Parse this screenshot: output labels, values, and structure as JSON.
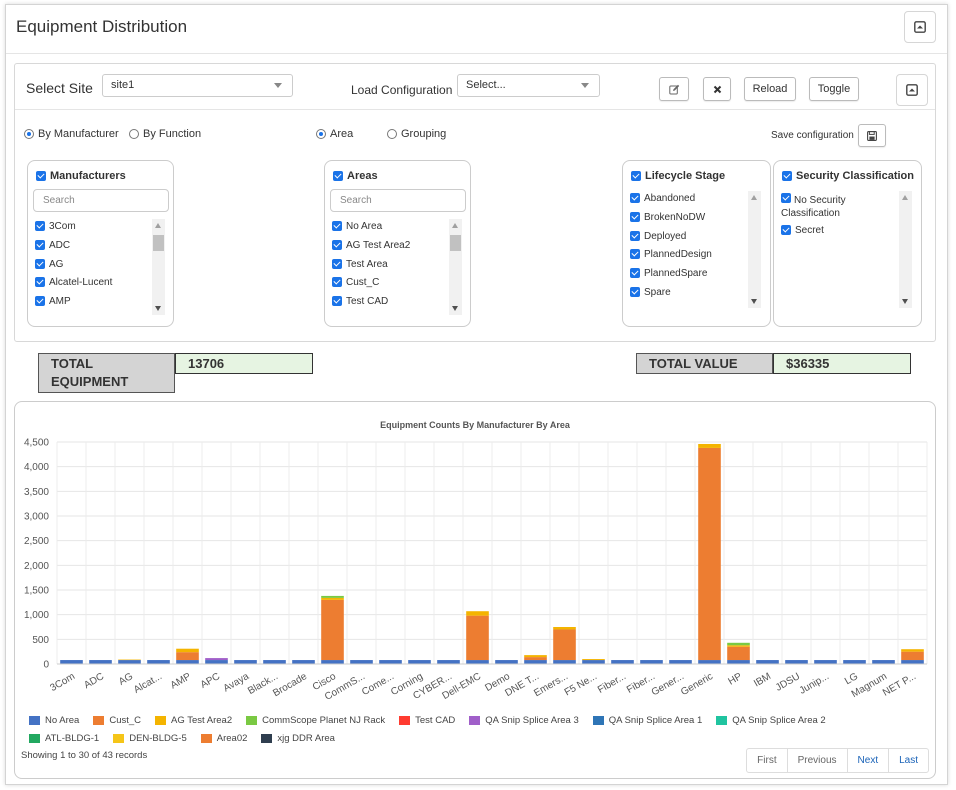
{
  "page": {
    "title": "Equipment Distribution"
  },
  "toolbar": {
    "select_site_label": "Select Site",
    "site_value": "site1",
    "load_config_label": "Load Configuration",
    "load_config_placeholder": "Select...",
    "reload_label": "Reload",
    "toggle_label": "Toggle",
    "save_config_label": "Save configuration"
  },
  "modes": {
    "by_manufacturer": "By Manufacturer",
    "by_function": "By Function",
    "area": "Area",
    "grouping": "Grouping"
  },
  "filters": {
    "manufacturers": {
      "title": "Manufacturers",
      "search_placeholder": "Search",
      "items": [
        "3Com",
        "ADC",
        "AG",
        "Alcatel-Lucent",
        "AMP"
      ]
    },
    "areas": {
      "title": "Areas",
      "search_placeholder": "Search",
      "items": [
        "No Area",
        "AG Test Area2",
        "Test Area",
        "Cust_C",
        "Test CAD"
      ]
    },
    "lifecycle": {
      "title": "Lifecycle Stage",
      "items": [
        "Abandoned",
        "BrokenNoDW",
        "Deployed",
        "PlannedDesign",
        "PlannedSpare",
        "Spare"
      ]
    },
    "security": {
      "title": "Security Classification",
      "items": [
        "No Security Classification",
        "Secret"
      ]
    }
  },
  "totals": {
    "equipment_label": "TOTAL EQUIPMENT",
    "equipment_value": "13706",
    "value_label": "TOTAL VALUE",
    "value_value": "$36335"
  },
  "chart_data": {
    "type": "bar",
    "stacked": true,
    "title": "Equipment Counts By Manufacturer By Area",
    "ylim": [
      0,
      4500
    ],
    "yticks": [
      "0",
      "500",
      "1,000",
      "1,500",
      "2,000",
      "2,500",
      "3,000",
      "3,500",
      "4,000",
      "4,500"
    ],
    "grid": true,
    "legend_position": "bottom",
    "categories": [
      "3Com",
      "ADC",
      "AG",
      "Alcat...",
      "AMP",
      "APC",
      "Avaya",
      "Black...",
      "Brocade",
      "Cisco",
      "CommS...",
      "Come...",
      "Corning",
      "CYBER...",
      "Dell-EMC",
      "Demo",
      "DNE T...",
      "Emers...",
      "F5 Ne...",
      "Fiber...",
      "Fiber...",
      "Gener...",
      "Generic",
      "HP",
      "IBM",
      "JDSU",
      "Junip...",
      "LG",
      "Magnum",
      "NET P..."
    ],
    "series": [
      {
        "name": "No Area",
        "color": "#4472c4",
        "values": [
          80,
          80,
          80,
          80,
          80,
          80,
          80,
          80,
          80,
          80,
          80,
          80,
          80,
          80,
          80,
          80,
          80,
          80,
          80,
          80,
          80,
          80,
          80,
          80,
          80,
          80,
          80,
          80,
          80,
          80
        ]
      },
      {
        "name": "Cust_C",
        "color": "#ed7d31",
        "values": [
          0,
          0,
          0,
          0,
          160,
          0,
          0,
          0,
          0,
          1220,
          0,
          0,
          0,
          0,
          900,
          0,
          60,
          620,
          0,
          0,
          0,
          0,
          4300,
          270,
          0,
          0,
          0,
          0,
          0,
          170
        ]
      },
      {
        "name": "AG Test Area2",
        "color": "#f4b400",
        "values": [
          0,
          0,
          10,
          0,
          70,
          0,
          0,
          0,
          0,
          40,
          0,
          0,
          0,
          0,
          90,
          0,
          40,
          50,
          20,
          0,
          0,
          0,
          80,
          30,
          0,
          0,
          0,
          0,
          0,
          50
        ]
      },
      {
        "name": "CommScope Planet NJ Rack",
        "color": "#7ac943",
        "values": [
          0,
          0,
          0,
          0,
          0,
          0,
          0,
          0,
          0,
          40,
          0,
          0,
          0,
          0,
          0,
          0,
          0,
          0,
          0,
          0,
          0,
          0,
          0,
          50,
          0,
          0,
          0,
          0,
          0,
          0
        ]
      },
      {
        "name": "Test CAD",
        "color": "#ff3b30",
        "values": [
          0,
          0,
          0,
          0,
          0,
          0,
          0,
          0,
          0,
          0,
          0,
          0,
          0,
          0,
          0,
          0,
          0,
          0,
          0,
          0,
          0,
          0,
          0,
          0,
          0,
          0,
          0,
          0,
          0,
          0
        ]
      },
      {
        "name": "QA Snip Splice Area 3",
        "color": "#a05fc9",
        "values": [
          0,
          0,
          0,
          0,
          0,
          40,
          0,
          0,
          0,
          0,
          0,
          0,
          0,
          0,
          0,
          0,
          0,
          0,
          0,
          0,
          0,
          0,
          0,
          0,
          0,
          0,
          0,
          0,
          0,
          0
        ]
      },
      {
        "name": "QA Snip Splice Area 1",
        "color": "#2e75b6",
        "values": [
          0,
          0,
          0,
          0,
          0,
          0,
          0,
          0,
          0,
          0,
          0,
          0,
          0,
          0,
          0,
          0,
          0,
          0,
          0,
          0,
          0,
          0,
          0,
          0,
          0,
          0,
          0,
          0,
          0,
          0
        ]
      },
      {
        "name": "QA Snip Splice Area 2",
        "color": "#20c4a0",
        "values": [
          0,
          0,
          0,
          0,
          0,
          0,
          0,
          0,
          0,
          0,
          0,
          0,
          0,
          0,
          0,
          0,
          0,
          0,
          0,
          0,
          0,
          0,
          0,
          0,
          0,
          0,
          0,
          0,
          0,
          0
        ]
      },
      {
        "name": "ATL-BLDG-1",
        "color": "#22a860",
        "values": [
          0,
          0,
          0,
          0,
          0,
          0,
          0,
          0,
          0,
          0,
          0,
          0,
          0,
          0,
          0,
          0,
          0,
          0,
          0,
          0,
          0,
          0,
          0,
          0,
          0,
          0,
          0,
          0,
          0,
          0
        ]
      },
      {
        "name": "DEN-BLDG-5",
        "color": "#f5c518",
        "values": [
          0,
          0,
          0,
          0,
          0,
          0,
          0,
          0,
          0,
          0,
          0,
          0,
          0,
          0,
          0,
          0,
          0,
          0,
          0,
          0,
          0,
          0,
          0,
          0,
          0,
          0,
          0,
          0,
          0,
          0
        ]
      },
      {
        "name": "Area02",
        "color": "#ed7d31",
        "values": [
          0,
          0,
          0,
          0,
          0,
          0,
          0,
          0,
          0,
          0,
          0,
          0,
          0,
          0,
          0,
          0,
          0,
          0,
          0,
          0,
          0,
          0,
          0,
          0,
          0,
          0,
          0,
          0,
          0,
          0
        ]
      },
      {
        "name": "xjg DDR Area",
        "color": "#2f3e4f",
        "values": [
          0,
          0,
          0,
          0,
          0,
          0,
          0,
          0,
          0,
          0,
          0,
          0,
          0,
          0,
          0,
          0,
          0,
          0,
          0,
          0,
          0,
          0,
          0,
          0,
          0,
          0,
          0,
          0,
          0,
          0
        ]
      }
    ]
  },
  "table": {
    "records_text": "Showing 1 to 30 of 43 records"
  },
  "pager": {
    "first": "First",
    "previous": "Previous",
    "next": "Next",
    "last": "Last"
  },
  "icons": {
    "collapse": "collapse-up-icon",
    "edit": "edit-icon",
    "clear": "close-icon",
    "save": "save-icon"
  }
}
